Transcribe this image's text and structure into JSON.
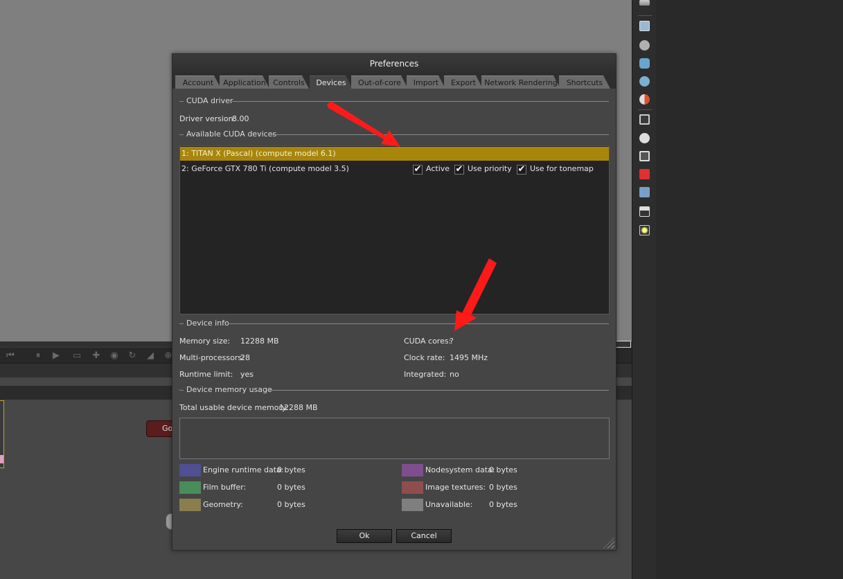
{
  "dialog": {
    "title": "Preferences",
    "tabs": [
      {
        "label": "Account"
      },
      {
        "label": "Application"
      },
      {
        "label": "Controls"
      },
      {
        "label": "Devices",
        "active": true
      },
      {
        "label": "Out-of-core"
      },
      {
        "label": "Import"
      },
      {
        "label": "Export"
      },
      {
        "label": "Network Rendering"
      },
      {
        "label": "Shortcuts"
      }
    ],
    "cuda_driver": {
      "section_label": "CUDA driver",
      "driver_version_label": "Driver version:",
      "driver_version": "8.00"
    },
    "devices": {
      "section_label": "Available CUDA devices",
      "list": [
        {
          "label": "1: TITAN X (Pascal) (compute model 6.1)",
          "selected": true
        },
        {
          "label": "2: GeForce GTX 780 Ti (compute model 3.5)",
          "selected": false
        }
      ],
      "options": {
        "active_label": "Active",
        "use_priority_label": "Use priority",
        "use_for_tonemap_label": "Use for tonemap",
        "active_checked": true,
        "use_priority_checked": true,
        "use_for_tonemap_checked": true
      }
    },
    "device_info": {
      "section_label": "Device info",
      "memory_size_label": "Memory size:",
      "memory_size": "12288 MB",
      "multiprocessors_label": "Multi-processors:",
      "multiprocessors": "28",
      "runtime_limit_label": "Runtime limit:",
      "runtime_limit": "yes",
      "cuda_cores_label": "CUDA cores:",
      "cuda_cores": "?",
      "clock_rate_label": "Clock rate:",
      "clock_rate": "1495 MHz",
      "integrated_label": "Integrated:",
      "integrated": "no"
    },
    "memory_usage": {
      "section_label": "Device memory usage",
      "total_label": "Total usable device memory:",
      "total": "12288 MB",
      "legend": [
        {
          "label": "Engine runtime data:",
          "value": "0 bytes",
          "color": "#4f4f91"
        },
        {
          "label": "Film buffer:",
          "value": "0 bytes",
          "color": "#4a8c5a"
        },
        {
          "label": "Geometry:",
          "value": "0 bytes",
          "color": "#8a7e4f"
        },
        {
          "label": "Nodesystem data:",
          "value": "0 bytes",
          "color": "#7e4f8e"
        },
        {
          "label": "Image textures:",
          "value": "0 bytes",
          "color": "#8e4e4e"
        },
        {
          "label": "Unavailable:",
          "value": "0 bytes",
          "color": "#7f7f7f"
        }
      ]
    },
    "buttons": {
      "ok": "Ok",
      "cancel": "Cancel"
    }
  },
  "background": {
    "go_button": "Go"
  },
  "colors": {
    "selection": "#a8860c",
    "annotation_arrow": "#ff1a1a"
  },
  "right_toolbar_icons": [
    "outliner-icon",
    "image-icon",
    "camera-icon",
    "mesh-icon",
    "scene-icon",
    "material-icon",
    "texture-icon",
    "clock-icon",
    "transform-icon",
    "red-cube-icon",
    "layers-icon",
    "imager-icon",
    "light-icon"
  ]
}
